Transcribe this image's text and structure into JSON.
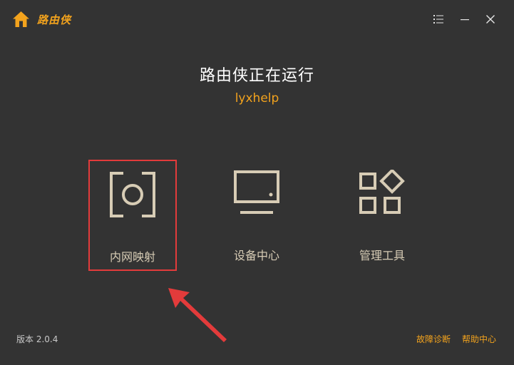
{
  "app": {
    "name": "路由侠"
  },
  "window_controls": {
    "menu_icon": "menu-icon",
    "minimize_icon": "minimize-icon",
    "close_icon": "close-icon"
  },
  "status": {
    "title": "路由侠正在运行",
    "account": "lyxhelp"
  },
  "features": [
    {
      "label": "内网映射",
      "icon": "port-mapping-icon",
      "highlighted": true
    },
    {
      "label": "设备中心",
      "icon": "monitor-icon",
      "highlighted": false
    },
    {
      "label": "管理工具",
      "icon": "tools-grid-icon",
      "highlighted": false
    }
  ],
  "footer": {
    "version": "版本 2.0.4",
    "diagnosis_link": "故障诊断",
    "help_link": "帮助中心"
  },
  "colors": {
    "background": "#333333",
    "accent": "#f3a31d",
    "icon": "#d7ccb5",
    "highlight": "#e33b3b"
  }
}
